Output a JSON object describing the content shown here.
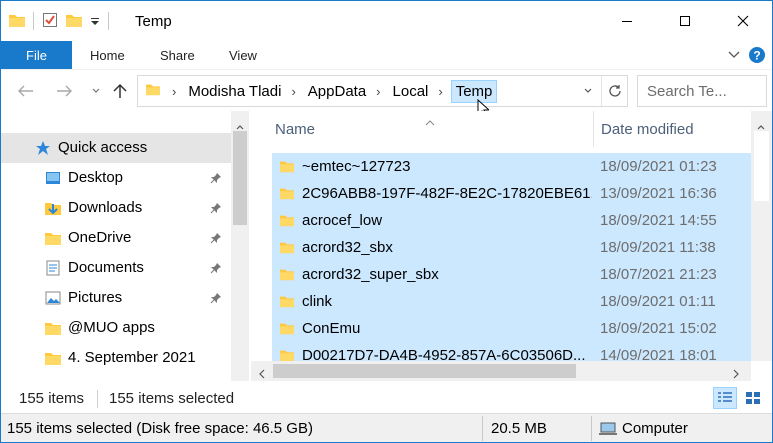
{
  "window": {
    "title": "Temp",
    "controls": {
      "minimize": "—",
      "maximize": "☐",
      "close": "✕"
    }
  },
  "ribbon": {
    "tabs": [
      "File",
      "Home",
      "Share",
      "View"
    ]
  },
  "address": {
    "crumbs": [
      "Modisha Tladi",
      "AppData",
      "Local"
    ],
    "current": "Temp"
  },
  "search": {
    "placeholder": "Search Te..."
  },
  "navigation": {
    "items": [
      {
        "label": "Quick access",
        "icon": "star-icon",
        "pinned": false
      },
      {
        "label": "Desktop",
        "icon": "desktop-folder-icon",
        "pinned": true
      },
      {
        "label": "Downloads",
        "icon": "downloads-folder-icon",
        "pinned": true
      },
      {
        "label": "OneDrive",
        "icon": "folder-icon",
        "pinned": true
      },
      {
        "label": "Documents",
        "icon": "documents-folder-icon",
        "pinned": true
      },
      {
        "label": "Pictures",
        "icon": "pictures-folder-icon",
        "pinned": true
      },
      {
        "label": "@MUO apps",
        "icon": "folder-icon",
        "pinned": false
      },
      {
        "label": "4. September 2021",
        "icon": "folder-icon",
        "pinned": false
      }
    ]
  },
  "columns": {
    "name": "Name",
    "date": "Date modified"
  },
  "files": [
    {
      "name": "~emtec~127723",
      "date": "18/09/2021 01:23"
    },
    {
      "name": "2C96ABB8-197F-482F-8E2C-17820EBE61...",
      "date": "13/09/2021 16:36"
    },
    {
      "name": "acrocef_low",
      "date": "18/09/2021 14:55"
    },
    {
      "name": "acrord32_sbx",
      "date": "18/09/2021 11:38"
    },
    {
      "name": "acrord32_super_sbx",
      "date": "18/07/2021 21:23"
    },
    {
      "name": "clink",
      "date": "18/09/2021 01:11"
    },
    {
      "name": "ConEmu",
      "date": "18/09/2021 15:02"
    },
    {
      "name": "D00217D7-DA4B-4952-857A-6C03506D...",
      "date": "14/09/2021 18:01"
    }
  ],
  "view_status": {
    "count": "155 items",
    "selected": "155 items selected"
  },
  "status": {
    "selection": "155 items selected (Disk free space: 46.5 GB)",
    "size": "20.5 MB",
    "location": "Computer"
  },
  "colors": {
    "accent": "#1979ca",
    "selection": "#cce8ff",
    "folder": "#ffc83d"
  }
}
